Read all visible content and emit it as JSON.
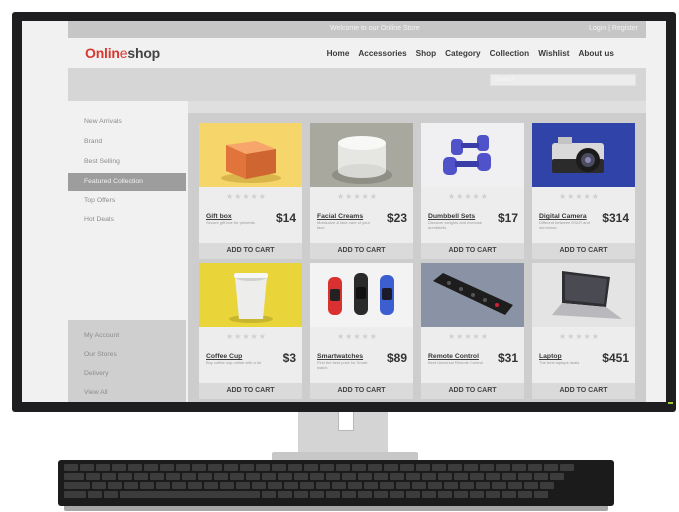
{
  "topbar": {
    "welcome": "Welcome to our Online Store",
    "links": "Login | Register"
  },
  "logo": {
    "part1": "Onlin",
    "part2": "e",
    "part3": "shop"
  },
  "nav": [
    "Home",
    "Accessories",
    "Shop",
    "Category",
    "Collection",
    "Wishlist",
    "About us"
  ],
  "search": {
    "placeholder": "Search"
  },
  "sidebar": {
    "top": [
      "New Arrivals",
      "Brand",
      "Best Selling",
      "Featured Collection",
      "Top Offers",
      "Hot Deals"
    ],
    "active_index": 3,
    "bottom": [
      "My Account",
      "Our Stores",
      "Delivery",
      "View All"
    ]
  },
  "cart_label": "ADD TO CART",
  "stars": "★★★★★",
  "products": [
    {
      "name": "Gift box",
      "desc": "Secure gift box for presents",
      "price": "$14",
      "icon": "gift-box-icon"
    },
    {
      "name": "Facial Creams",
      "desc": "Moisturize & take care of your face",
      "price": "$23",
      "icon": "cream-jar-icon"
    },
    {
      "name": "Dumbbell Sets",
      "desc": "Discover weights and exercise dumbbells",
      "price": "$17",
      "icon": "dumbbell-icon"
    },
    {
      "name": "Digital Camera",
      "desc": "Different between DSLR and mirrorless",
      "price": "$314",
      "icon": "camera-icon"
    },
    {
      "name": "Coffee Cup",
      "desc": "Buy coffee cup online with a lid",
      "price": "$3",
      "icon": "coffee-cup-icon"
    },
    {
      "name": "Smartwatches",
      "desc": "Find the best price for Smart watch",
      "price": "$89",
      "icon": "smartwatch-icon"
    },
    {
      "name": "Remote Control",
      "desc": "Best Universal Remote Control",
      "price": "$31",
      "icon": "remote-control-icon"
    },
    {
      "name": "Laptop",
      "desc": "The best laptops deals",
      "price": "$451",
      "icon": "laptop-icon"
    }
  ],
  "colors": {
    "accent": "#d7382f",
    "active_sidebar": "#9d9d9d",
    "topbar": "#c6c6c6"
  }
}
